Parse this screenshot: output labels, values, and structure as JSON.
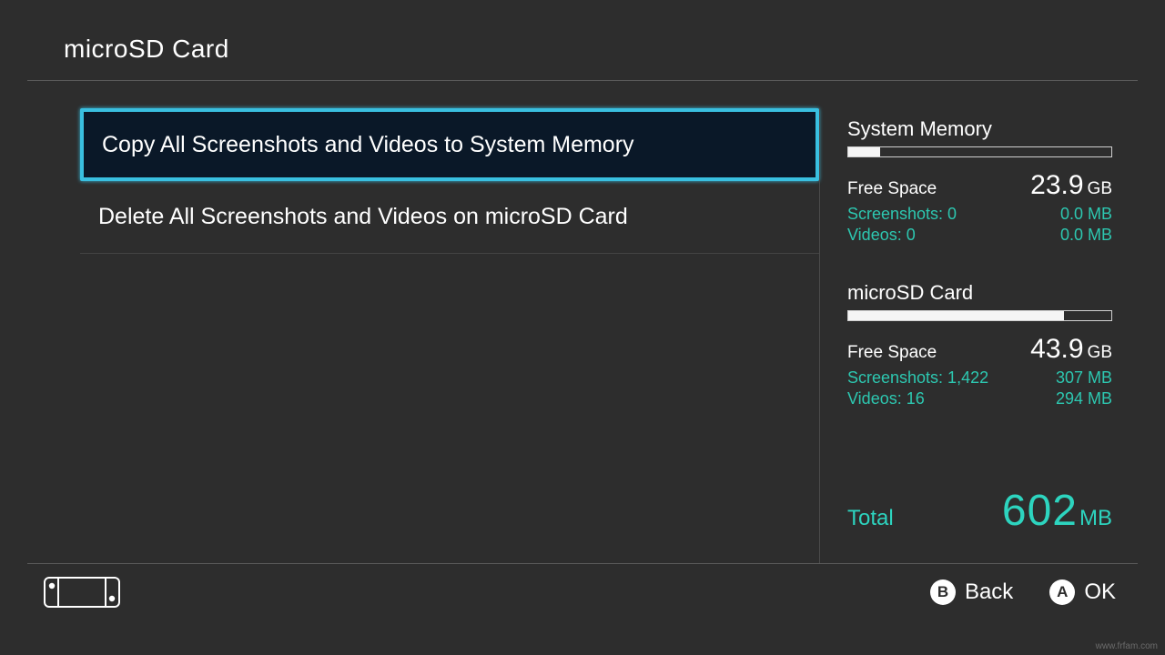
{
  "header": {
    "title": "microSD Card"
  },
  "menu": {
    "items": [
      {
        "label": "Copy All Screenshots and Videos to System Memory",
        "selected": true
      },
      {
        "label": "Delete All Screenshots and Videos on microSD Card",
        "selected": false
      }
    ]
  },
  "storage": {
    "system": {
      "title": "System Memory",
      "fill_percent": 12,
      "free_label": "Free Space",
      "free_value": "23.9",
      "free_unit": "GB",
      "screenshots_label": "Screenshots: 0",
      "screenshots_size": "0.0 MB",
      "videos_label": "Videos: 0",
      "videos_size": "0.0 MB"
    },
    "sd": {
      "title": "microSD Card",
      "fill_percent": 82,
      "free_label": "Free Space",
      "free_value": "43.9",
      "free_unit": "GB",
      "screenshots_label": "Screenshots: 1,422",
      "screenshots_size": "307 MB",
      "videos_label": "Videos: 16",
      "videos_size": "294 MB"
    },
    "total": {
      "label": "Total",
      "value": "602",
      "unit": "MB"
    }
  },
  "footer": {
    "back": {
      "button": "B",
      "label": "Back"
    },
    "ok": {
      "button": "A",
      "label": "OK"
    }
  },
  "watermark": "www.frfam.com"
}
